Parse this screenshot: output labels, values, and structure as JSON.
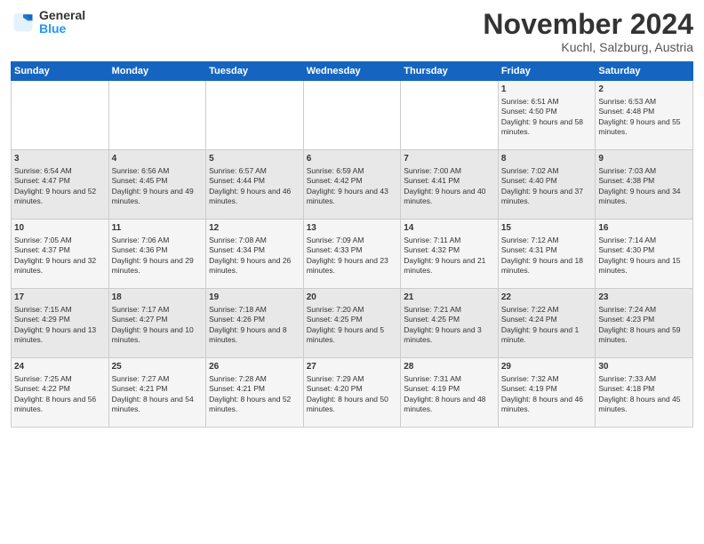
{
  "logo": {
    "general": "General",
    "blue": "Blue"
  },
  "title": "November 2024",
  "location": "Kuchl, Salzburg, Austria",
  "days_of_week": [
    "Sunday",
    "Monday",
    "Tuesday",
    "Wednesday",
    "Thursday",
    "Friday",
    "Saturday"
  ],
  "weeks": [
    [
      null,
      null,
      null,
      null,
      null,
      {
        "day": "1",
        "sunrise": "Sunrise: 6:51 AM",
        "sunset": "Sunset: 4:50 PM",
        "daylight": "Daylight: 9 hours and 58 minutes."
      },
      {
        "day": "2",
        "sunrise": "Sunrise: 6:53 AM",
        "sunset": "Sunset: 4:48 PM",
        "daylight": "Daylight: 9 hours and 55 minutes."
      }
    ],
    [
      {
        "day": "3",
        "sunrise": "Sunrise: 6:54 AM",
        "sunset": "Sunset: 4:47 PM",
        "daylight": "Daylight: 9 hours and 52 minutes."
      },
      {
        "day": "4",
        "sunrise": "Sunrise: 6:56 AM",
        "sunset": "Sunset: 4:45 PM",
        "daylight": "Daylight: 9 hours and 49 minutes."
      },
      {
        "day": "5",
        "sunrise": "Sunrise: 6:57 AM",
        "sunset": "Sunset: 4:44 PM",
        "daylight": "Daylight: 9 hours and 46 minutes."
      },
      {
        "day": "6",
        "sunrise": "Sunrise: 6:59 AM",
        "sunset": "Sunset: 4:42 PM",
        "daylight": "Daylight: 9 hours and 43 minutes."
      },
      {
        "day": "7",
        "sunrise": "Sunrise: 7:00 AM",
        "sunset": "Sunset: 4:41 PM",
        "daylight": "Daylight: 9 hours and 40 minutes."
      },
      {
        "day": "8",
        "sunrise": "Sunrise: 7:02 AM",
        "sunset": "Sunset: 4:40 PM",
        "daylight": "Daylight: 9 hours and 37 minutes."
      },
      {
        "day": "9",
        "sunrise": "Sunrise: 7:03 AM",
        "sunset": "Sunset: 4:38 PM",
        "daylight": "Daylight: 9 hours and 34 minutes."
      }
    ],
    [
      {
        "day": "10",
        "sunrise": "Sunrise: 7:05 AM",
        "sunset": "Sunset: 4:37 PM",
        "daylight": "Daylight: 9 hours and 32 minutes."
      },
      {
        "day": "11",
        "sunrise": "Sunrise: 7:06 AM",
        "sunset": "Sunset: 4:36 PM",
        "daylight": "Daylight: 9 hours and 29 minutes."
      },
      {
        "day": "12",
        "sunrise": "Sunrise: 7:08 AM",
        "sunset": "Sunset: 4:34 PM",
        "daylight": "Daylight: 9 hours and 26 minutes."
      },
      {
        "day": "13",
        "sunrise": "Sunrise: 7:09 AM",
        "sunset": "Sunset: 4:33 PM",
        "daylight": "Daylight: 9 hours and 23 minutes."
      },
      {
        "day": "14",
        "sunrise": "Sunrise: 7:11 AM",
        "sunset": "Sunset: 4:32 PM",
        "daylight": "Daylight: 9 hours and 21 minutes."
      },
      {
        "day": "15",
        "sunrise": "Sunrise: 7:12 AM",
        "sunset": "Sunset: 4:31 PM",
        "daylight": "Daylight: 9 hours and 18 minutes."
      },
      {
        "day": "16",
        "sunrise": "Sunrise: 7:14 AM",
        "sunset": "Sunset: 4:30 PM",
        "daylight": "Daylight: 9 hours and 15 minutes."
      }
    ],
    [
      {
        "day": "17",
        "sunrise": "Sunrise: 7:15 AM",
        "sunset": "Sunset: 4:29 PM",
        "daylight": "Daylight: 9 hours and 13 minutes."
      },
      {
        "day": "18",
        "sunrise": "Sunrise: 7:17 AM",
        "sunset": "Sunset: 4:27 PM",
        "daylight": "Daylight: 9 hours and 10 minutes."
      },
      {
        "day": "19",
        "sunrise": "Sunrise: 7:18 AM",
        "sunset": "Sunset: 4:26 PM",
        "daylight": "Daylight: 9 hours and 8 minutes."
      },
      {
        "day": "20",
        "sunrise": "Sunrise: 7:20 AM",
        "sunset": "Sunset: 4:25 PM",
        "daylight": "Daylight: 9 hours and 5 minutes."
      },
      {
        "day": "21",
        "sunrise": "Sunrise: 7:21 AM",
        "sunset": "Sunset: 4:25 PM",
        "daylight": "Daylight: 9 hours and 3 minutes."
      },
      {
        "day": "22",
        "sunrise": "Sunrise: 7:22 AM",
        "sunset": "Sunset: 4:24 PM",
        "daylight": "Daylight: 9 hours and 1 minute."
      },
      {
        "day": "23",
        "sunrise": "Sunrise: 7:24 AM",
        "sunset": "Sunset: 4:23 PM",
        "daylight": "Daylight: 8 hours and 59 minutes."
      }
    ],
    [
      {
        "day": "24",
        "sunrise": "Sunrise: 7:25 AM",
        "sunset": "Sunset: 4:22 PM",
        "daylight": "Daylight: 8 hours and 56 minutes."
      },
      {
        "day": "25",
        "sunrise": "Sunrise: 7:27 AM",
        "sunset": "Sunset: 4:21 PM",
        "daylight": "Daylight: 8 hours and 54 minutes."
      },
      {
        "day": "26",
        "sunrise": "Sunrise: 7:28 AM",
        "sunset": "Sunset: 4:21 PM",
        "daylight": "Daylight: 8 hours and 52 minutes."
      },
      {
        "day": "27",
        "sunrise": "Sunrise: 7:29 AM",
        "sunset": "Sunset: 4:20 PM",
        "daylight": "Daylight: 8 hours and 50 minutes."
      },
      {
        "day": "28",
        "sunrise": "Sunrise: 7:31 AM",
        "sunset": "Sunset: 4:19 PM",
        "daylight": "Daylight: 8 hours and 48 minutes."
      },
      {
        "day": "29",
        "sunrise": "Sunrise: 7:32 AM",
        "sunset": "Sunset: 4:19 PM",
        "daylight": "Daylight: 8 hours and 46 minutes."
      },
      {
        "day": "30",
        "sunrise": "Sunrise: 7:33 AM",
        "sunset": "Sunset: 4:18 PM",
        "daylight": "Daylight: 8 hours and 45 minutes."
      }
    ]
  ]
}
